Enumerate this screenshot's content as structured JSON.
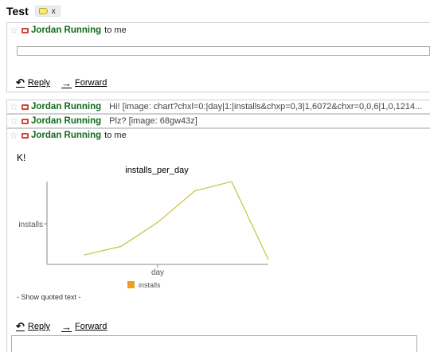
{
  "thread": {
    "title": "Test",
    "label_remove": "x"
  },
  "messages": [
    {
      "sender": "Jordan Running",
      "recipient": "to me",
      "reply_label": "Reply",
      "forward_label": "Forward"
    },
    {
      "sender": "Jordan Running",
      "snippet": "Hi! [image: chart?chxl=0:|day|1:|installs&chxp=0,3|1,6072&chxr=0,0,6|1,0,1214..."
    },
    {
      "sender": "Jordan Running",
      "snippet": "Plz? [image: 68gw43z]"
    },
    {
      "sender": "Jordan Running",
      "recipient": "to me",
      "body": "K!",
      "show_quoted": "- Show quoted text -",
      "reply_label": "Reply",
      "forward_label": "Forward"
    }
  ],
  "colors": {
    "sender": "#0f6b1c",
    "series": "#c8c84c",
    "legend": "#f0a020",
    "chat_icon": "#d6463c"
  },
  "icons": {
    "star": "star-icon",
    "chat": "chat-icon",
    "reply": "reply-arrow-icon",
    "forward": "forward-arrow-icon",
    "label": "label-tag-icon"
  },
  "chart_data": {
    "type": "line",
    "title": "installs_per_day",
    "xlabel": "day",
    "ylabel": "installs",
    "x": [
      0,
      1,
      2,
      3,
      4,
      5
    ],
    "xlim": [
      0,
      6
    ],
    "series": [
      {
        "name": "installs",
        "values": [
          0.06,
          0.17,
          0.48,
          0.88,
          1.0,
          0.0
        ]
      }
    ],
    "ylim": [
      0,
      1
    ],
    "grid": false,
    "legend": "bottom"
  }
}
